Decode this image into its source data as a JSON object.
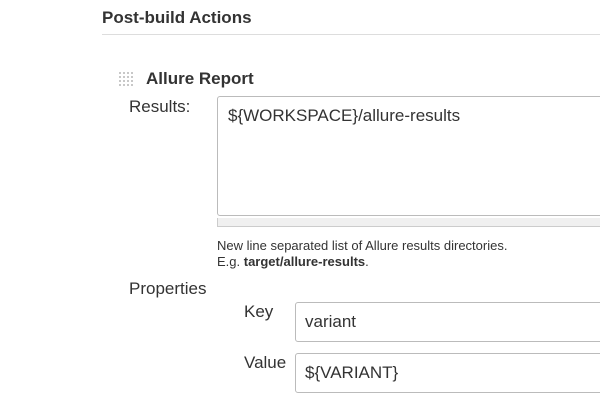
{
  "section": {
    "title": "Post-build Actions"
  },
  "allure": {
    "title": "Allure Report",
    "results_label": "Results:",
    "results_value": "${WORKSPACE}/allure-results",
    "help_line1": "New line separated list of Allure results directories.",
    "help_line2_prefix": "E.g. ",
    "help_line2_example": "target/allure-results",
    "help_line2_suffix": ".",
    "properties_label": "Properties",
    "property": {
      "key_label": "Key",
      "key_value": "variant",
      "value_label": "Value",
      "value_value": "${VARIANT}"
    }
  },
  "icons": {
    "drag_handle": "drag-handle-icon"
  }
}
